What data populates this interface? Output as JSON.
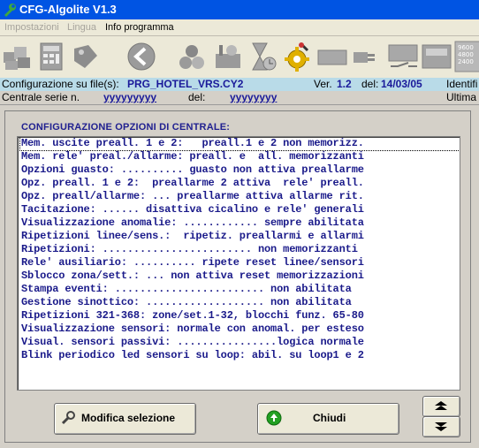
{
  "window": {
    "title": "CFG-Algolite V1.3"
  },
  "menu": {
    "items": [
      {
        "label": "Impostazioni",
        "enabled": false
      },
      {
        "label": "Lingua",
        "enabled": false
      },
      {
        "label": "Info programma",
        "enabled": true
      }
    ]
  },
  "toolbar": {
    "icons": [
      "boxes-icon",
      "calculator-icon",
      "tag-icon",
      "back-arrow-icon",
      "parts-icon",
      "tools-box-icon",
      "hourglass-icon",
      "gear-icon",
      "blank-button-icon",
      "plug-icon",
      "switch-icon",
      "lcd-panel-icon",
      "connector-icon",
      "baud-rate-icon"
    ],
    "baud_labels": [
      "9600",
      "4800",
      "2400"
    ]
  },
  "info": {
    "config_label": "Configurazione su file(s):",
    "config_file": "PRG_HOTEL_VRS.CY2",
    "ver_label": "Ver.",
    "ver_value": "1.2",
    "del_label": "del:",
    "del_value": "14/03/05",
    "identif_label": "Identifi",
    "serie_label": "Centrale serie n.",
    "serie_value": "yyyyyyyyy",
    "del2_label": "del:",
    "del2_value": "yyyyyyyy",
    "ultima_label": "Ultima"
  },
  "panel": {
    "title": "CONFIGURAZIONE OPZIONI DI CENTRALE:",
    "options": [
      "Mem. uscite preall. 1 e 2:   preall.1 e 2 non memorizz.",
      "Mem. rele' preal./allarme: preall. e  all. memorizzanti",
      "Opzioni guasto: .......... guasto non attiva preallarme",
      "Opz. preall. 1 e 2:  preallarme 2 attiva  rele' preall.",
      "Opz. preall/allarme: ... preallarme attiva allarme rit.",
      "Tacitazione: ...... disattiva cicalino e rele' generali",
      "Visualizzazione anomalie: ............ sempre abilitata",
      "Ripetizioni linee/sens.:  ripetiz. preallarmi e allarmi",
      "Ripetizioni: ........................ non memorizzanti",
      "Rele' ausiliario: .......... ripete reset linee/sensori",
      "Sblocco zona/sett.: ... non attiva reset memorizzazioni",
      "Stampa eventi: ........................ non abilitata",
      "Gestione sinottico: ................... non abilitata",
      "Ripetizioni 321-368: zone/set.1-32, blocchi funz. 65-80",
      "Visualizzazione sensori: normale con anomal. per esteso",
      "Visual. sensori passivi: ................logica normale",
      "Blink periodico led sensori su loop: abil. su loop1 e 2"
    ]
  },
  "buttons": {
    "modifica": "Modifica selezione",
    "chiudi": "Chiudi"
  },
  "colors": {
    "title_bar": "#0054e3",
    "info_bar": "#b9dbe8",
    "text_blue": "#1a1a8a"
  }
}
